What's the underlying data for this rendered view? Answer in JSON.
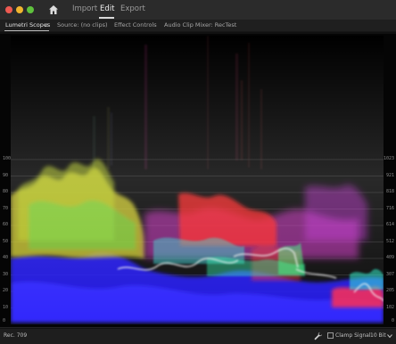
{
  "window": {
    "controls": [
      "close",
      "minimize",
      "maximize"
    ]
  },
  "nav": {
    "home_icon": "home-icon",
    "items": [
      {
        "label": "Import",
        "active": false
      },
      {
        "label": "Edit",
        "active": true
      },
      {
        "label": "Export",
        "active": false
      }
    ]
  },
  "panel_tabs": {
    "items": [
      {
        "label": "Lumetri Scopes",
        "active": true
      },
      {
        "label": "Source: (no clips)",
        "active": false
      },
      {
        "label": "Effect Controls",
        "active": false
      },
      {
        "label": "Audio Clip Mixer: RecTest",
        "active": false
      }
    ],
    "menu_icon": "≡"
  },
  "scope": {
    "left_ticks": [
      "100",
      "90",
      "80",
      "70",
      "60",
      "50",
      "40",
      "30",
      "20",
      "10",
      "0"
    ],
    "right_ticks": [
      "1023",
      "921",
      "818",
      "716",
      "614",
      "512",
      "409",
      "307",
      "205",
      "102",
      "0"
    ]
  },
  "status": {
    "colorspace": "Rec. 709",
    "wrench_icon": "wrench-icon",
    "clamp_label": "Clamp Signal",
    "clamp_checked": false,
    "bit_depth": "10 Bit"
  },
  "colors": {
    "red": "#ff2a2a",
    "green": "#2cff6b",
    "blue": "#2b2bff",
    "yellow": "#e7e22b",
    "magenta": "#e82bd7",
    "cyan": "#22e6d8"
  }
}
